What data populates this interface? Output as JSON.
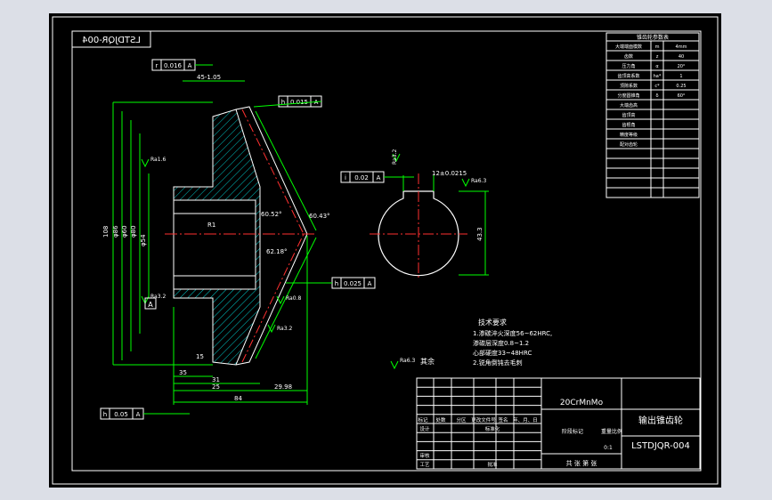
{
  "drawing": {
    "part_code": "LSTDJQR-004",
    "part_code_mirrored": "LSTDJQR-004",
    "part_name": "输出锥齿轮",
    "material": "20CrMnMo",
    "scale": "0:1",
    "sheet_label": "共 张 第 张",
    "general_roughness": "其余"
  },
  "tolerance_frames": [
    {
      "symbol": "r",
      "value": "0.016",
      "datum": "A"
    },
    {
      "symbol": "h",
      "value": "0.015",
      "datum": "A"
    },
    {
      "symbol": "i",
      "value": "0.02",
      "datum": "A"
    },
    {
      "symbol": "h",
      "value": "0.025",
      "datum": "A"
    },
    {
      "symbol": "h",
      "value": "0.05",
      "datum": "A"
    }
  ],
  "datum_label": "A",
  "dimensions": {
    "top": "45-1.05",
    "bore": "φ40",
    "angle1": "60.52°",
    "angle2": "62.18°",
    "tip": "60.43°",
    "r1": "R1",
    "d1": "108",
    "d2": "φ86",
    "d3": "φ60",
    "d4": "φ80",
    "d5": "φ54",
    "b1": "15",
    "b2": "31",
    "b3": "25",
    "b4": "29.98",
    "b5": "84",
    "b6": "35",
    "keyway": "12±0.0215",
    "keyway2": "φ40",
    "key_h": "43.3",
    "rough1": "Ra1.6",
    "rough2": "Ra0.8",
    "rough3": "Ra3.2",
    "rough4": "Ra3.2",
    "rough5": "Ra3.2",
    "rough6": "Ra6.3"
  },
  "notes": {
    "title": "技术要求",
    "lines": [
      "1.渗碳淬火深度56~62HRC,",
      "  渗碳层深度0.8~1.2",
      "  心部硬度33~48HRC",
      "2.锐角倒钝去毛刺"
    ]
  },
  "gear_table": {
    "header": "锥齿轮参数表",
    "rows": [
      [
        "大端端面模数",
        "m",
        "4mm"
      ],
      [
        "齿数",
        "z",
        "40"
      ],
      [
        "压力角",
        "α",
        "20°"
      ],
      [
        "齿顶高系数",
        "ha*",
        "1"
      ],
      [
        "顶隙系数",
        "c*",
        "0.25"
      ],
      [
        "分度圆锥角",
        "δ",
        "60°"
      ],
      [
        "大端齿高",
        "",
        ""
      ],
      [
        "齿顶高",
        "",
        ""
      ],
      [
        "齿根角",
        "",
        ""
      ],
      [
        "精度等级",
        "",
        ""
      ],
      [
        "配对齿轮",
        "",
        ""
      ],
      [
        "",
        "",
        ""
      ],
      [
        "",
        "",
        ""
      ],
      [
        "",
        "",
        ""
      ],
      [
        "",
        "",
        ""
      ],
      [
        "",
        "",
        ""
      ]
    ]
  },
  "title_block": {
    "headers": [
      "标记",
      "处数",
      "分区",
      "更改文件号",
      "签名",
      "年、月、日"
    ],
    "roles": [
      "设计",
      "标准化",
      "审核",
      "工艺",
      "批准"
    ],
    "stage_label": "阶段标记",
    "weight_label": "重量",
    "scale_label": "比例"
  }
}
